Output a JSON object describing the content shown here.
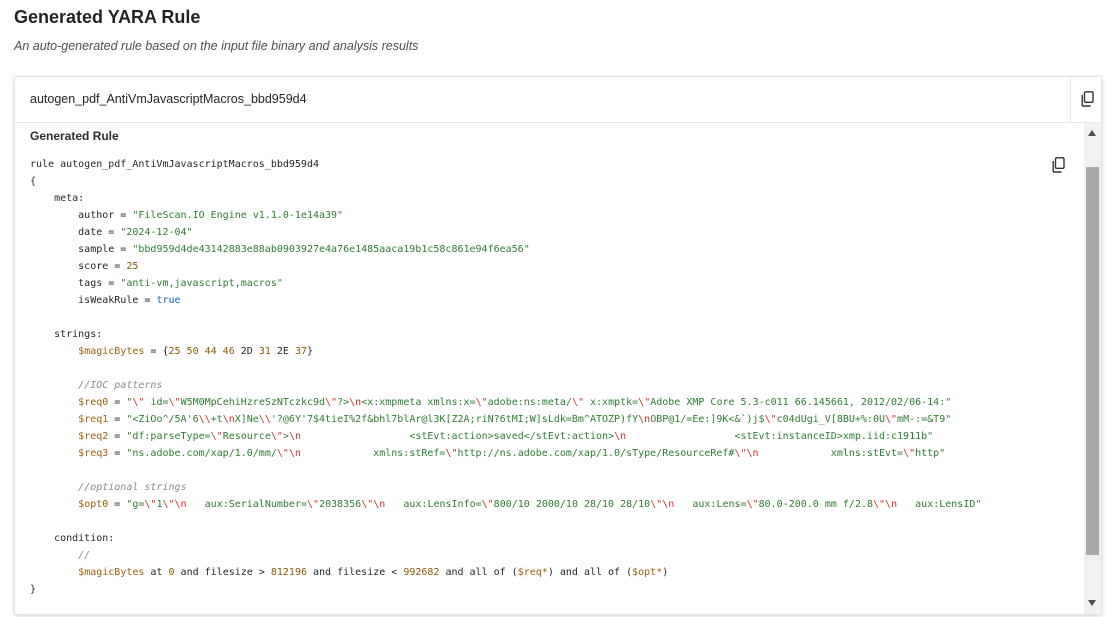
{
  "page": {
    "title": "Generated YARA Rule",
    "subtitle": "An auto-generated rule based on the input file binary and analysis results"
  },
  "card": {
    "rule_name": "autogen_pdf_AntiVmJavascriptMacros_bbd959d4",
    "section_label": "Generated Rule",
    "icons": {
      "copy_header": "copy-icon",
      "copy_code": "copy-icon"
    }
  },
  "code": {
    "lines": [
      [
        {
          "t": "rule autogen_pdf_AntiVmJavascriptMacros_bbd959d4"
        }
      ],
      [
        {
          "t": "{"
        }
      ],
      [
        {
          "t": "    meta:"
        }
      ],
      [
        {
          "t": "        author = "
        },
        {
          "t": "\"FileScan.IO Engine v1.1.0-1e14a39\"",
          "c": "str"
        }
      ],
      [
        {
          "t": "        date = "
        },
        {
          "t": "\"2024-12-04\"",
          "c": "str"
        }
      ],
      [
        {
          "t": "        sample = "
        },
        {
          "t": "\"bbd959d4de43142883e88ab0903927e4a76e1485aaca19b1c58c861e94f6ea56\"",
          "c": "str"
        }
      ],
      [
        {
          "t": "        score = "
        },
        {
          "t": "25",
          "c": "num"
        }
      ],
      [
        {
          "t": "        tags = "
        },
        {
          "t": "\"anti-vm,javascript,macros\"",
          "c": "str"
        }
      ],
      [
        {
          "t": "        isWeakRule = "
        },
        {
          "t": "true",
          "c": "kw"
        }
      ],
      [],
      [
        {
          "t": "    strings:"
        }
      ],
      [
        {
          "t": "        "
        },
        {
          "t": "$magicBytes",
          "c": "var"
        },
        {
          "t": " = {"
        },
        {
          "t": "25 50 44 46",
          "c": "num"
        },
        {
          "t": " 2D "
        },
        {
          "t": "31",
          "c": "num"
        },
        {
          "t": " 2E "
        },
        {
          "t": "37",
          "c": "num"
        },
        {
          "t": "}"
        }
      ],
      [],
      [
        {
          "t": "        //IOC patterns",
          "c": "cmt"
        }
      ],
      [
        {
          "t": "        "
        },
        {
          "t": "$req0",
          "c": "var"
        },
        {
          "t": " = "
        },
        {
          "t": "\"",
          "c": "str"
        },
        {
          "t": "\\\"",
          "c": "esc"
        },
        {
          "t": " id=",
          "c": "str"
        },
        {
          "t": "\\\"",
          "c": "esc"
        },
        {
          "t": "W5M0MpCehiHzreSzNTczkc9d",
          "c": "str"
        },
        {
          "t": "\\\"",
          "c": "esc"
        },
        {
          "t": "?>",
          "c": "str"
        },
        {
          "t": "\\n",
          "c": "esc"
        },
        {
          "t": "<x:xmpmeta xmlns:x=",
          "c": "str"
        },
        {
          "t": "\\\"",
          "c": "esc"
        },
        {
          "t": "adobe:ns:meta/",
          "c": "str"
        },
        {
          "t": "\\\"",
          "c": "esc"
        },
        {
          "t": " x:xmptk=",
          "c": "str"
        },
        {
          "t": "\\\"",
          "c": "esc"
        },
        {
          "t": "Adobe XMP Core 5.3-c011 66.145661, 2012/02/06-14:\"",
          "c": "str"
        }
      ],
      [
        {
          "t": "        "
        },
        {
          "t": "$req1",
          "c": "var"
        },
        {
          "t": " = "
        },
        {
          "t": "\"<ZiOo^/5A'6",
          "c": "str"
        },
        {
          "t": "\\\\",
          "c": "esc"
        },
        {
          "t": "+t",
          "c": "str"
        },
        {
          "t": "\\n",
          "c": "esc"
        },
        {
          "t": "X]Ne",
          "c": "str"
        },
        {
          "t": "\\\\",
          "c": "esc"
        },
        {
          "t": "'?@6Y'7$4tieI%2f&bhl7blAr@l3K[Z2A;riN?6tMI;W]sLdk=Bm^ATOZP)fY",
          "c": "str"
        },
        {
          "t": "\\n",
          "c": "esc"
        },
        {
          "t": "OBP@1/=Ee:]9K<&`)j$",
          "c": "str"
        },
        {
          "t": "\\\"",
          "c": "esc"
        },
        {
          "t": "c04dUgi_V[8BU+%:0U",
          "c": "str"
        },
        {
          "t": "\\\"",
          "c": "esc"
        },
        {
          "t": "mM-:=&T9\"",
          "c": "str"
        }
      ],
      [
        {
          "t": "        "
        },
        {
          "t": "$req2",
          "c": "var"
        },
        {
          "t": " = "
        },
        {
          "t": "\"df:parseType=",
          "c": "str"
        },
        {
          "t": "\\\"",
          "c": "esc"
        },
        {
          "t": "Resource",
          "c": "str"
        },
        {
          "t": "\\\"",
          "c": "esc"
        },
        {
          "t": ">",
          "c": "str"
        },
        {
          "t": "\\n",
          "c": "esc"
        },
        {
          "t": "                  <stEvt:action>saved</stEvt:action>",
          "c": "str"
        },
        {
          "t": "\\n",
          "c": "esc"
        },
        {
          "t": "                  <stEvt:instanceID>xmp.iid:c1911b\"",
          "c": "str"
        }
      ],
      [
        {
          "t": "        "
        },
        {
          "t": "$req3",
          "c": "var"
        },
        {
          "t": " = "
        },
        {
          "t": "\"ns.adobe.com/xap/1.0/mm/",
          "c": "str"
        },
        {
          "t": "\\\"",
          "c": "esc"
        },
        {
          "t": "\\n",
          "c": "esc"
        },
        {
          "t": "            xmlns:stRef=",
          "c": "str"
        },
        {
          "t": "\\\"",
          "c": "esc"
        },
        {
          "t": "http://ns.adobe.com/xap/1.0/sType/ResourceRef#",
          "c": "str"
        },
        {
          "t": "\\\"",
          "c": "esc"
        },
        {
          "t": "\\n",
          "c": "esc"
        },
        {
          "t": "            xmlns:stEvt=",
          "c": "str"
        },
        {
          "t": "\\\"",
          "c": "esc"
        },
        {
          "t": "http\"",
          "c": "str"
        }
      ],
      [],
      [
        {
          "t": "        //optional strings",
          "c": "cmt"
        }
      ],
      [
        {
          "t": "        "
        },
        {
          "t": "$opt0",
          "c": "var"
        },
        {
          "t": " = "
        },
        {
          "t": "\"g=",
          "c": "str"
        },
        {
          "t": "\\\"",
          "c": "esc"
        },
        {
          "t": "1",
          "c": "str"
        },
        {
          "t": "\\\"",
          "c": "esc"
        },
        {
          "t": "\\n",
          "c": "esc"
        },
        {
          "t": "   aux:SerialNumber=",
          "c": "str"
        },
        {
          "t": "\\\"",
          "c": "esc"
        },
        {
          "t": "2038356",
          "c": "str"
        },
        {
          "t": "\\\"",
          "c": "esc"
        },
        {
          "t": "\\n",
          "c": "esc"
        },
        {
          "t": "   aux:LensInfo=",
          "c": "str"
        },
        {
          "t": "\\\"",
          "c": "esc"
        },
        {
          "t": "800/10 2000/10 28/10 28/10",
          "c": "str"
        },
        {
          "t": "\\\"",
          "c": "esc"
        },
        {
          "t": "\\n",
          "c": "esc"
        },
        {
          "t": "   aux:Lens=",
          "c": "str"
        },
        {
          "t": "\\\"",
          "c": "esc"
        },
        {
          "t": "80.0-200.0 mm f/2.8",
          "c": "str"
        },
        {
          "t": "\\\"",
          "c": "esc"
        },
        {
          "t": "\\n",
          "c": "esc"
        },
        {
          "t": "   aux:LensID\"",
          "c": "str"
        }
      ],
      [],
      [
        {
          "t": "    condition:"
        }
      ],
      [
        {
          "t": "        //",
          "c": "cmt"
        }
      ],
      [
        {
          "t": "        "
        },
        {
          "t": "$magicBytes",
          "c": "var"
        },
        {
          "t": " at "
        },
        {
          "t": "0",
          "c": "num"
        },
        {
          "t": " and filesize > "
        },
        {
          "t": "812196",
          "c": "num"
        },
        {
          "t": " and filesize < "
        },
        {
          "t": "992682",
          "c": "num"
        },
        {
          "t": " and all of ("
        },
        {
          "t": "$req*",
          "c": "var"
        },
        {
          "t": ") and all of ("
        },
        {
          "t": "$opt*",
          "c": "var"
        },
        {
          "t": ")"
        }
      ],
      [
        {
          "t": "}"
        }
      ]
    ]
  }
}
